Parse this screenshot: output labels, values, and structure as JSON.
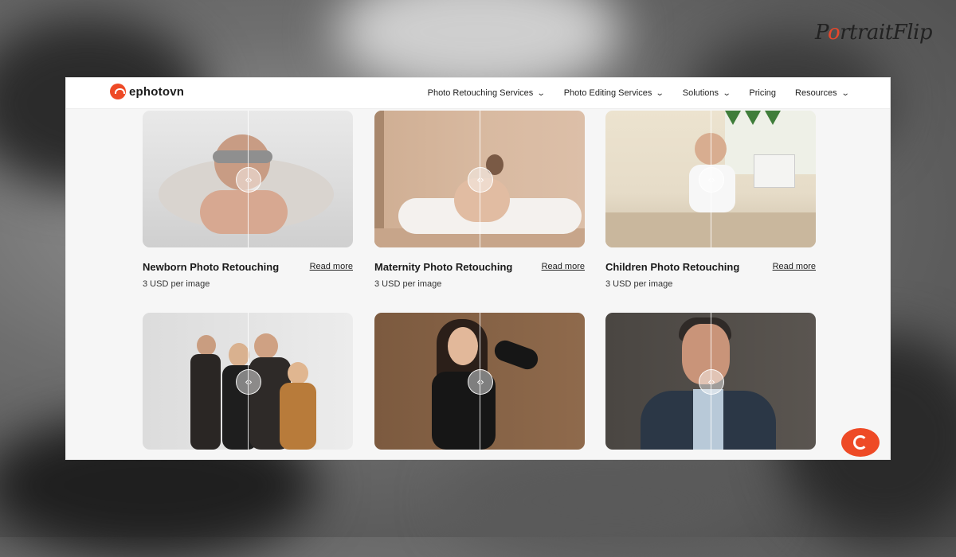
{
  "watermark": {
    "brand": "PortraitFlip"
  },
  "header": {
    "logo_text": "ephotovn",
    "nav": [
      {
        "label": "Photo Retouching Services",
        "has_dropdown": true
      },
      {
        "label": "Photo Editing Services",
        "has_dropdown": true
      },
      {
        "label": "Solutions",
        "has_dropdown": true
      },
      {
        "label": "Pricing",
        "has_dropdown": false
      },
      {
        "label": "Resources",
        "has_dropdown": true
      }
    ]
  },
  "cards": [
    {
      "title": "Newborn Photo Retouching",
      "read_more": "Read more",
      "price": "3 USD per image"
    },
    {
      "title": "Maternity Photo Retouching",
      "read_more": "Read more",
      "price": "3 USD per image"
    },
    {
      "title": "Children Photo Retouching",
      "read_more": "Read more",
      "price": "3 USD per image"
    },
    {
      "title": "",
      "read_more": "",
      "price": ""
    },
    {
      "title": "",
      "read_more": "",
      "price": ""
    },
    {
      "title": "",
      "read_more": "",
      "price": ""
    }
  ],
  "colors": {
    "accent": "#ee4a26"
  },
  "icons": {
    "slider_handle": "compare-handle-icon",
    "chat": "chat-icon"
  }
}
